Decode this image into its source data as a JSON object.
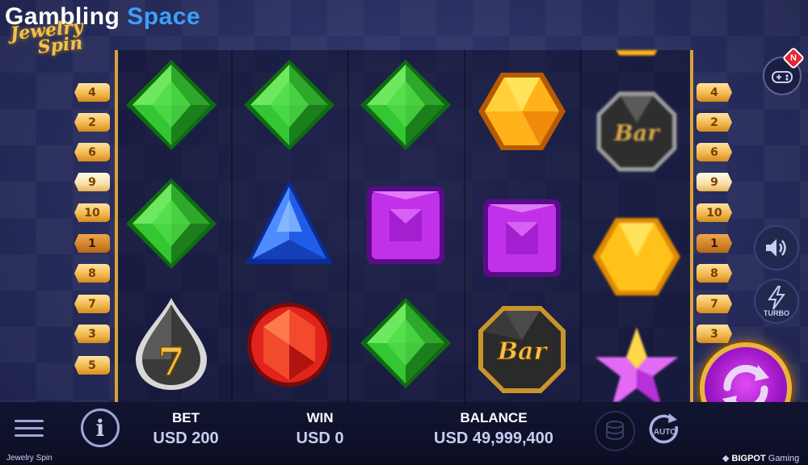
{
  "brand": {
    "word1": "Gambling",
    "word2": "Space"
  },
  "logo": {
    "line1": "Jewelry",
    "line2": "Spin"
  },
  "paylines": {
    "left": [
      "4",
      "2",
      "6",
      "9",
      "10",
      "1",
      "8",
      "7",
      "3",
      "5"
    ],
    "right": [
      "4",
      "2",
      "6",
      "9",
      "10",
      "1",
      "8",
      "7",
      "3"
    ]
  },
  "symbol_text": {
    "seven": "7",
    "bar": "Bar"
  },
  "reels": [
    [
      "green-diamond",
      "green-diamond",
      "seven-drop"
    ],
    [
      "green-diamond",
      "blue-triangle",
      "red-round"
    ],
    [
      "green-diamond",
      "purple-square",
      "green-diamond"
    ],
    [
      "yellow-hexagon",
      "purple-square",
      "bar-octagon"
    ],
    [
      "bar-octagon",
      "yellow-hexagon",
      "star"
    ]
  ],
  "controls": {
    "bet_label": "BET",
    "bet_value": "USD 200",
    "win_label": "WIN",
    "win_value": "USD 0",
    "balance_label": "BALANCE",
    "balance_value": "USD 49,999,400",
    "info_label": "i",
    "auto_label": "AUTO",
    "turbo_label": "TURBO",
    "notification_badge": "N"
  },
  "footer": {
    "game_name": "Jewelry Spin",
    "provider_bold": "BIGPOT",
    "provider_rest": " Gaming"
  },
  "colors": {
    "accent_gold": "#e9b440",
    "spin_purple": "#a018c8",
    "brand_blue": "#3aa0ff"
  }
}
